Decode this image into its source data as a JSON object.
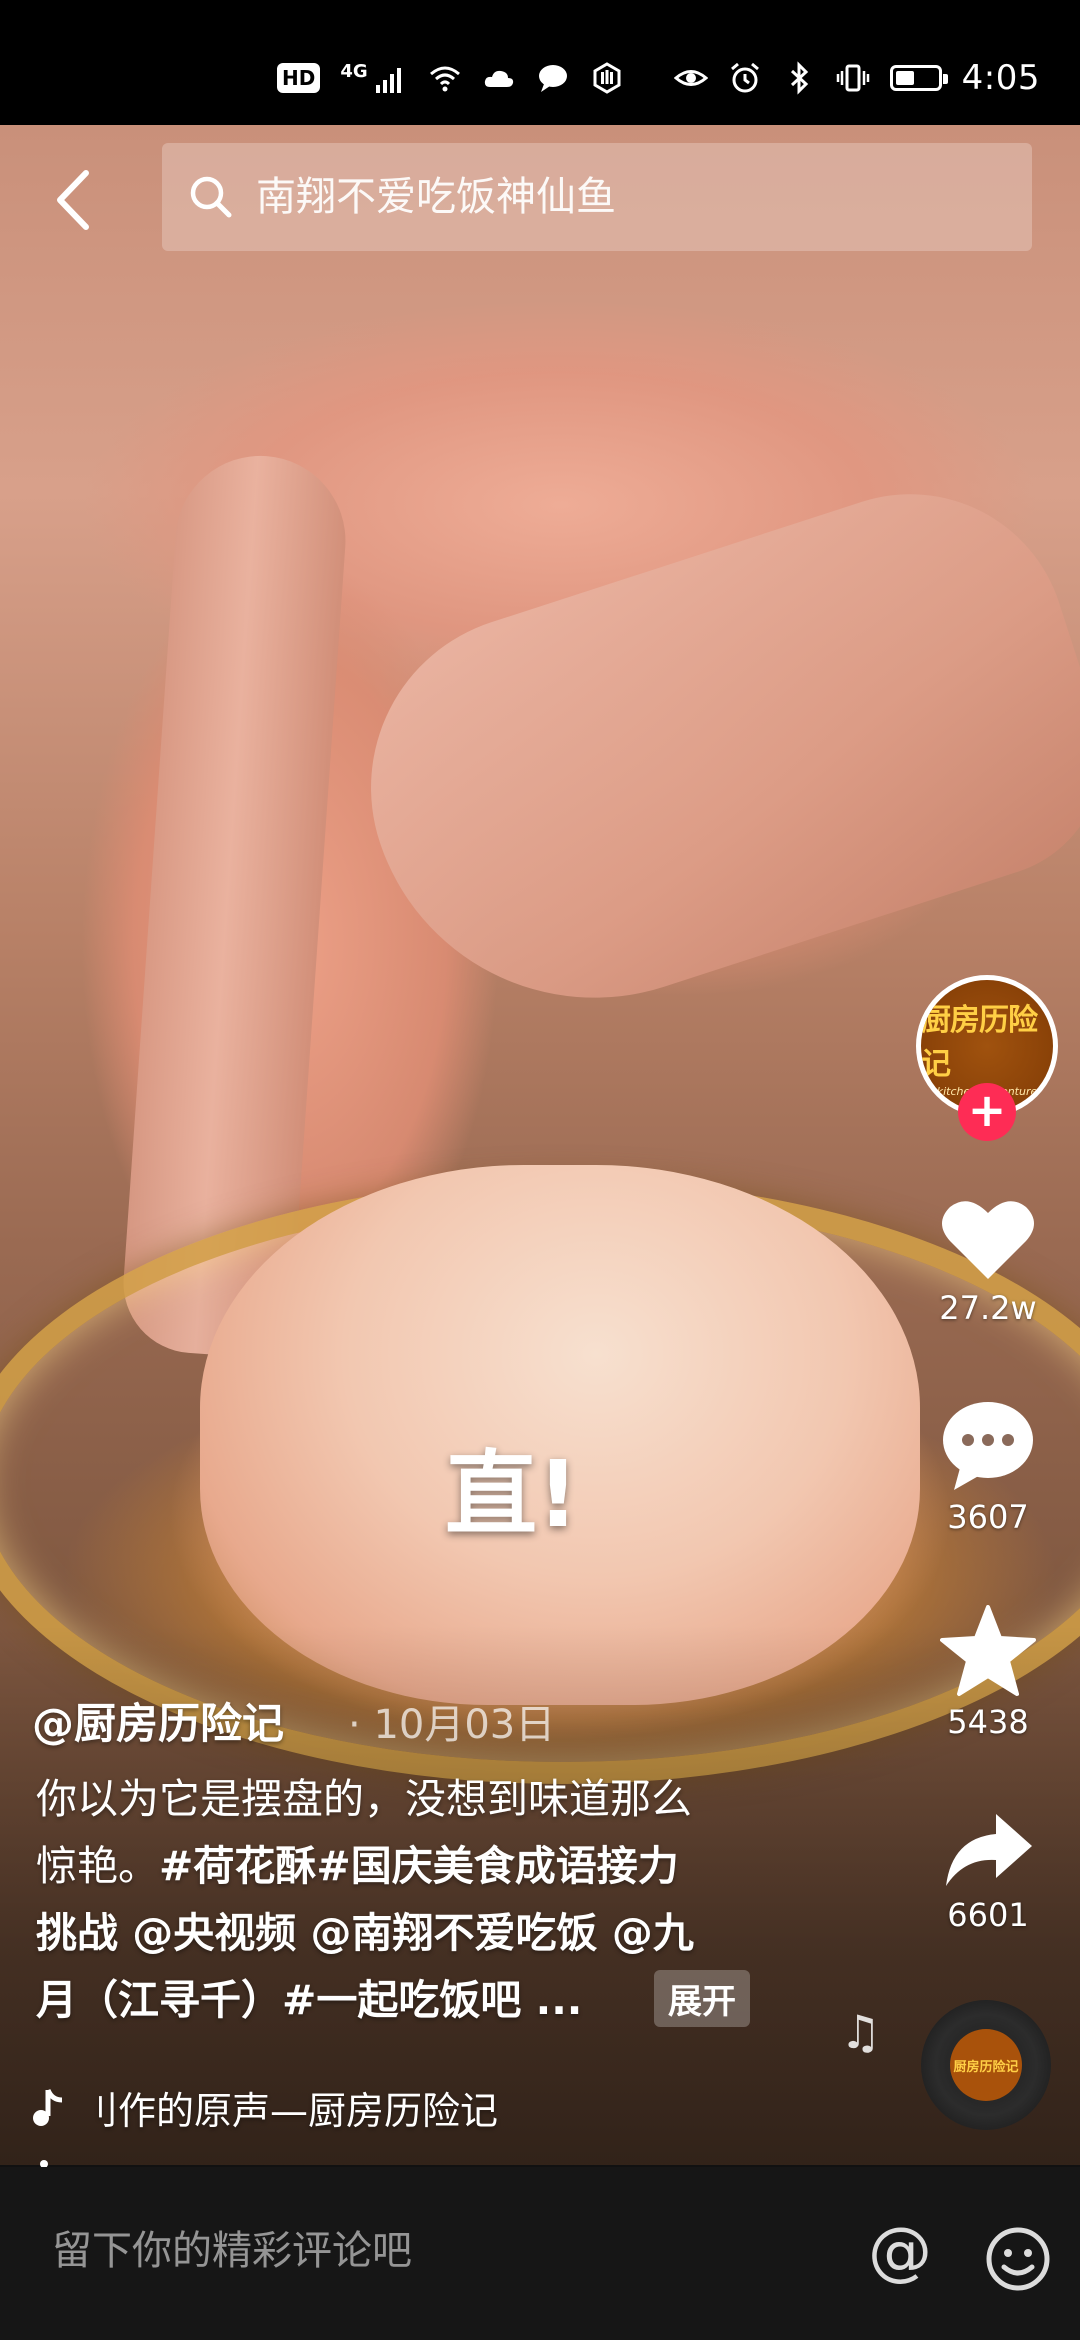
{
  "status_bar": {
    "hd": "HD",
    "network": "4G",
    "time": "4:05",
    "battery_level": 0.45
  },
  "search": {
    "placeholder": "南翔不爱吃饭神仙鱼"
  },
  "video": {
    "caption": "直!"
  },
  "creator": {
    "avatar_text": "厨房历险记",
    "avatar_subtext": "kitchen adventure",
    "follow_symbol": "+"
  },
  "actions": {
    "likes": "27.2w",
    "comments": "3607",
    "favorites": "5438",
    "shares": "6601"
  },
  "post": {
    "author": "@厨房历险记",
    "date": "10月03日",
    "description_line1": "你以为它是摆盘的，没想到味道那么",
    "description_line2_plain": "惊艳。",
    "description_line2_tags": "#荷花酥#国庆美食成语接力",
    "description_line3": "挑战 @央视频 @南翔不爱吃饭 @九",
    "description_line4": "月（江寻千）#一起吃饭吧 ...",
    "expand_label": "展开",
    "music": "刂作的原声—厨房历险记"
  },
  "comment_bar": {
    "placeholder": "留下你的精彩评论吧",
    "mention_symbol": "@"
  },
  "icons": {
    "back": "chevron-left-icon",
    "search": "search-icon",
    "like": "heart-icon",
    "comment": "comment-bubble-icon",
    "favorite": "star-icon",
    "share": "share-arrow-icon",
    "music": "music-note-icon",
    "emoji": "smiley-icon"
  },
  "colors": {
    "follow_accent": "#fe2c55",
    "avatar_bg": "#8a4208",
    "avatar_text": "#ffcf45"
  }
}
